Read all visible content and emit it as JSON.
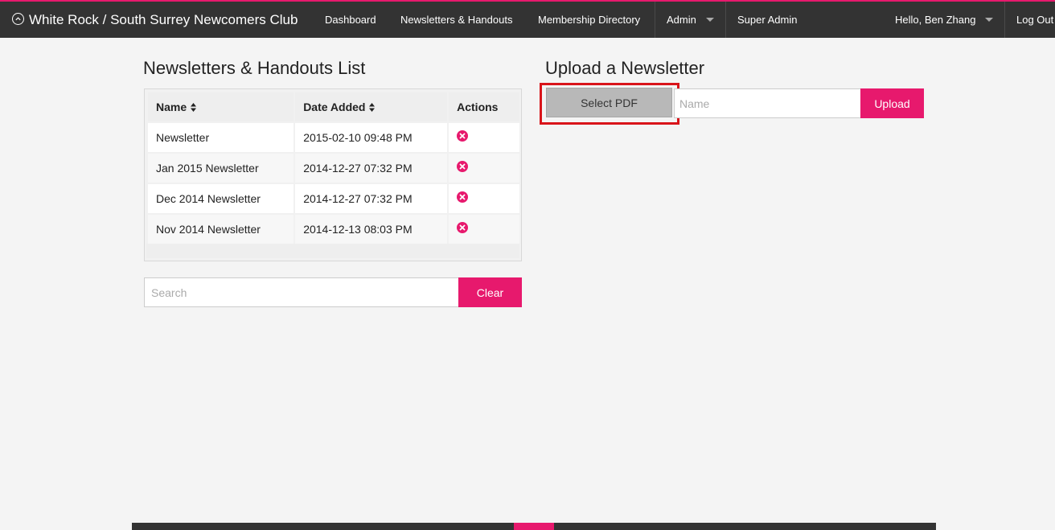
{
  "nav": {
    "brand": "White Rock / South Surrey Newcomers Club",
    "brand_icon": "chevron-up-circle-icon",
    "items": [
      "Dashboard",
      "Newsletters & Handouts",
      "Membership Directory",
      "Admin",
      "Super Admin"
    ],
    "user_greeting": "Hello, Ben Zhang",
    "logout": "Log Out"
  },
  "list": {
    "title": "Newsletters & Handouts List",
    "columns": [
      "Name",
      "Date Added",
      "Actions"
    ],
    "rows": [
      {
        "name": "Newsletter",
        "date": "2015-02-10 09:48 PM"
      },
      {
        "name": "Jan 2015 Newsletter",
        "date": "2014-12-27 07:32 PM"
      },
      {
        "name": "Dec 2014 Newsletter",
        "date": "2014-12-27 07:32 PM"
      },
      {
        "name": "Nov 2014 Newsletter",
        "date": "2014-12-13 08:03 PM"
      }
    ],
    "search_placeholder": "Search",
    "clear_label": "Clear"
  },
  "upload": {
    "title": "Upload a Newsletter",
    "select_label": "Select PDF",
    "name_placeholder": "Name",
    "upload_label": "Upload"
  },
  "colors": {
    "accent": "#e7196d",
    "navbar": "#333333",
    "highlight": "#d9141a"
  }
}
